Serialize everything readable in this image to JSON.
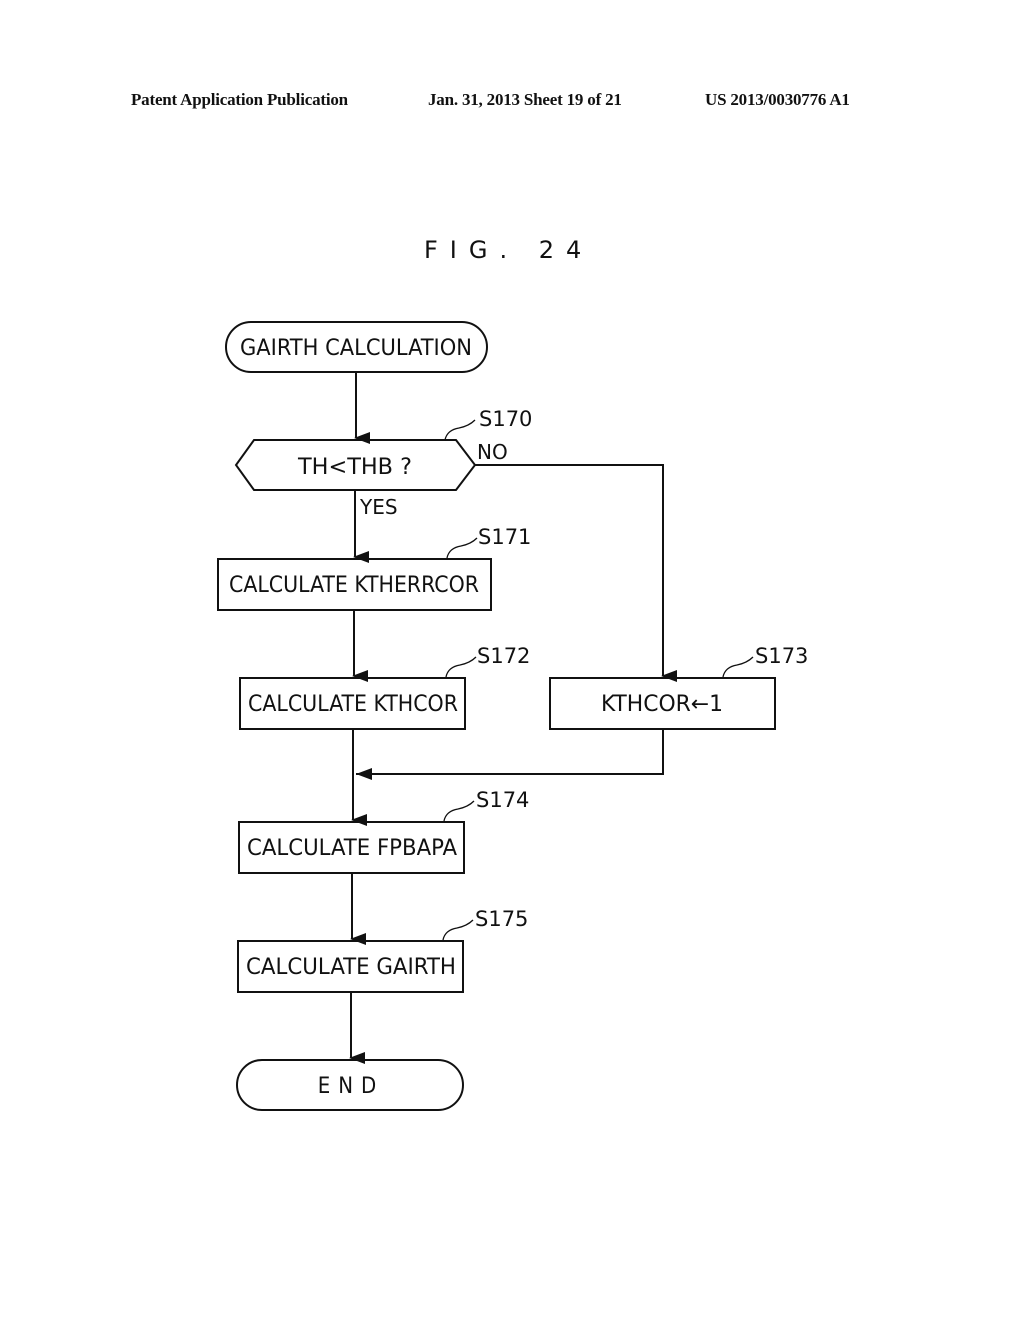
{
  "header": {
    "left": "Patent Application Publication",
    "middle": "Jan. 31, 2013   Sheet 19 of 21",
    "right": "US 2013/0030776 A1"
  },
  "figure": {
    "title": "FIG. 24"
  },
  "flowchart": {
    "start": "GAIRTH CALCULATION",
    "decision": {
      "step": "S170",
      "text": "TH<THB ?",
      "yes_label": "YES",
      "no_label": "NO"
    },
    "steps": [
      {
        "id": "S171",
        "text": "CALCULATE KTHERRCOR"
      },
      {
        "id": "S172",
        "text": "CALCULATE KTHCOR"
      },
      {
        "id": "S173",
        "text": "KTHCOR←1"
      },
      {
        "id": "S174",
        "text": "CALCULATE FPBAPA"
      },
      {
        "id": "S175",
        "text": "CALCULATE GAIRTH"
      }
    ],
    "end": "END"
  }
}
